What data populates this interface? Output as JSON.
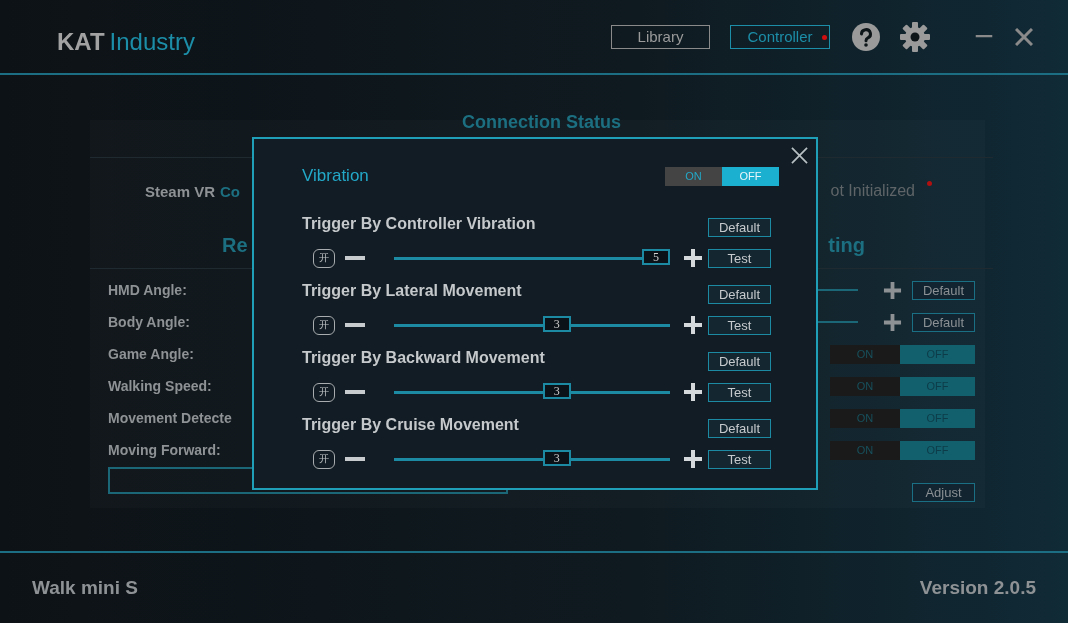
{
  "header": {
    "brand_bold": "KAT",
    "brand_light": "Industry",
    "nav": [
      {
        "label": "Library",
        "selected": false,
        "alert": false
      },
      {
        "label": "Controller",
        "selected": true,
        "alert": true
      }
    ]
  },
  "background": {
    "section_title": "Connection Status",
    "status_label": "Steam VR",
    "status_value": "Co",
    "status_right": "ot Initialized",
    "status_alert": true,
    "left_heading": "Re",
    "right_heading": "ting",
    "settings": [
      {
        "label": "HMD Angle:",
        "kind": "slider",
        "button": "Default"
      },
      {
        "label": "Body Angle:",
        "kind": "slider",
        "button": "Default"
      },
      {
        "label": "Game Angle:",
        "kind": "toggle",
        "on_label": "ON",
        "off_label": "OFF",
        "on": false
      },
      {
        "label": "Walking Speed:",
        "kind": "toggle",
        "on_label": "ON",
        "off_label": "OFF",
        "on": false
      },
      {
        "label": "Movement Detecte",
        "kind": "toggle",
        "on_label": "ON",
        "off_label": "OFF",
        "on": false
      },
      {
        "label": "Moving Forward:",
        "kind": "toggle",
        "on_label": "ON",
        "off_label": "OFF",
        "on": false
      }
    ],
    "adjust_button": "Adjust"
  },
  "dialog": {
    "title": "Vibration",
    "on_label": "ON",
    "off_label": "OFF",
    "on": false,
    "items": [
      {
        "label": "Trigger By Controller Vibration",
        "default_button": "Default",
        "key": "开",
        "level": 1,
        "value": "5",
        "test_button": "Test"
      },
      {
        "label": "Trigger By Lateral Movement",
        "default_button": "Default",
        "key": "开",
        "level": 0.6,
        "value": "3",
        "test_button": "Test"
      },
      {
        "label": "Trigger By Backward Movement",
        "default_button": "Default",
        "key": "开",
        "level": 0.6,
        "value": "3",
        "test_button": "Test"
      },
      {
        "label": "Trigger By Cruise Movement",
        "default_button": "Default",
        "key": "开",
        "level": 0.6,
        "value": "3",
        "test_button": "Test"
      }
    ]
  },
  "footer": {
    "device": "Walk mini S",
    "version": "Version 2.0.5"
  }
}
